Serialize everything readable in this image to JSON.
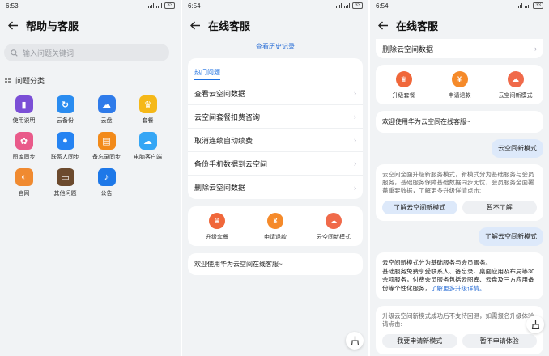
{
  "panel1": {
    "time": "6:53",
    "battery": "33",
    "title": "帮助与客服",
    "search_placeholder": "输入问题关键词",
    "section_label": "问题分类",
    "categories": [
      {
        "label": "使用说明",
        "icon": "book-icon",
        "color": "#7b4fd6"
      },
      {
        "label": "云备份",
        "icon": "cloud-sync-icon",
        "color": "#2a8cf0"
      },
      {
        "label": "云盘",
        "icon": "cloud-drive-icon",
        "color": "#2f7bea"
      },
      {
        "label": "套餐",
        "icon": "crown-icon",
        "color": "#f5b818"
      },
      {
        "label": "图库同步",
        "icon": "gallery-icon",
        "color": "#e95a8a"
      },
      {
        "label": "联系人同步",
        "icon": "contact-icon",
        "color": "#2583f2"
      },
      {
        "label": "备忘录同步",
        "icon": "notes-icon",
        "color": "#f28a1a"
      },
      {
        "label": "电脑客户端",
        "icon": "cloud-pc-icon",
        "color": "#35a6f5"
      },
      {
        "label": "官网",
        "icon": "website-icon",
        "color": "#f08a30"
      },
      {
        "label": "其他问题",
        "icon": "document-icon",
        "color": "#6c4a2e"
      },
      {
        "label": "公告",
        "icon": "bell-icon",
        "color": "#1e78e8"
      }
    ]
  },
  "panel2": {
    "time": "6:54",
    "battery": "33",
    "title": "在线客服",
    "history_link": "查看历史记录",
    "hot_tab": "热门问题",
    "questions": [
      "查看云空间数据",
      "云空间套餐扣费咨询",
      "取消连续自动续费",
      "备份手机数据到云空间",
      "删除云空间数据"
    ],
    "services": [
      {
        "label": "升级套餐",
        "icon": "crown-icon",
        "color": "#f0673a"
      },
      {
        "label": "申请退款",
        "icon": "refund-icon",
        "color": "#f58a2a"
      },
      {
        "label": "云空间新模式",
        "icon": "cloud-icon",
        "color": "#f06a4a"
      }
    ],
    "welcome": "欢迎使用华为云空间在线客服~"
  },
  "panel3": {
    "time": "6:54",
    "battery": "33",
    "title": "在线客服",
    "top_item": "删除云空间数据",
    "services": [
      {
        "label": "升级套餐",
        "icon": "crown-icon",
        "color": "#f0673a"
      },
      {
        "label": "申请退款",
        "icon": "refund-icon",
        "color": "#f58a2a"
      },
      {
        "label": "云空间新模式",
        "icon": "cloud-icon",
        "color": "#f06a4a"
      }
    ],
    "welcome": "欢迎使用华为云空间在线客服~",
    "user_msg_1": "云空间新模式",
    "reply_1": "云空间全面升级新服务模式，新模式分为基础服务与会员服务，基础服务保障基础数据同步无忧，会员服务全面覆盖重要数据，了解更多升级详情点击:",
    "btn_learn": "了解云空间新模式",
    "btn_skip": "暂不了解",
    "user_msg_2": "了解云空间新模式",
    "reply_2_a": "云空间新模式分为基础服务与会员服务。",
    "reply_2_b": "基础服务免费享受联系人、备忘录、桌面应用及布局等30余项服务，付费会员服务包括云图库、云盘及三方应用备份等个性化服务，",
    "reply_2_link": "了解更多升级详情。",
    "reply_3": "升级云空间新模式成功后不支持回退，如需报名升级体验请点击:",
    "btn_apply": "我要申请新模式",
    "btn_no": "暂不申请体验"
  }
}
